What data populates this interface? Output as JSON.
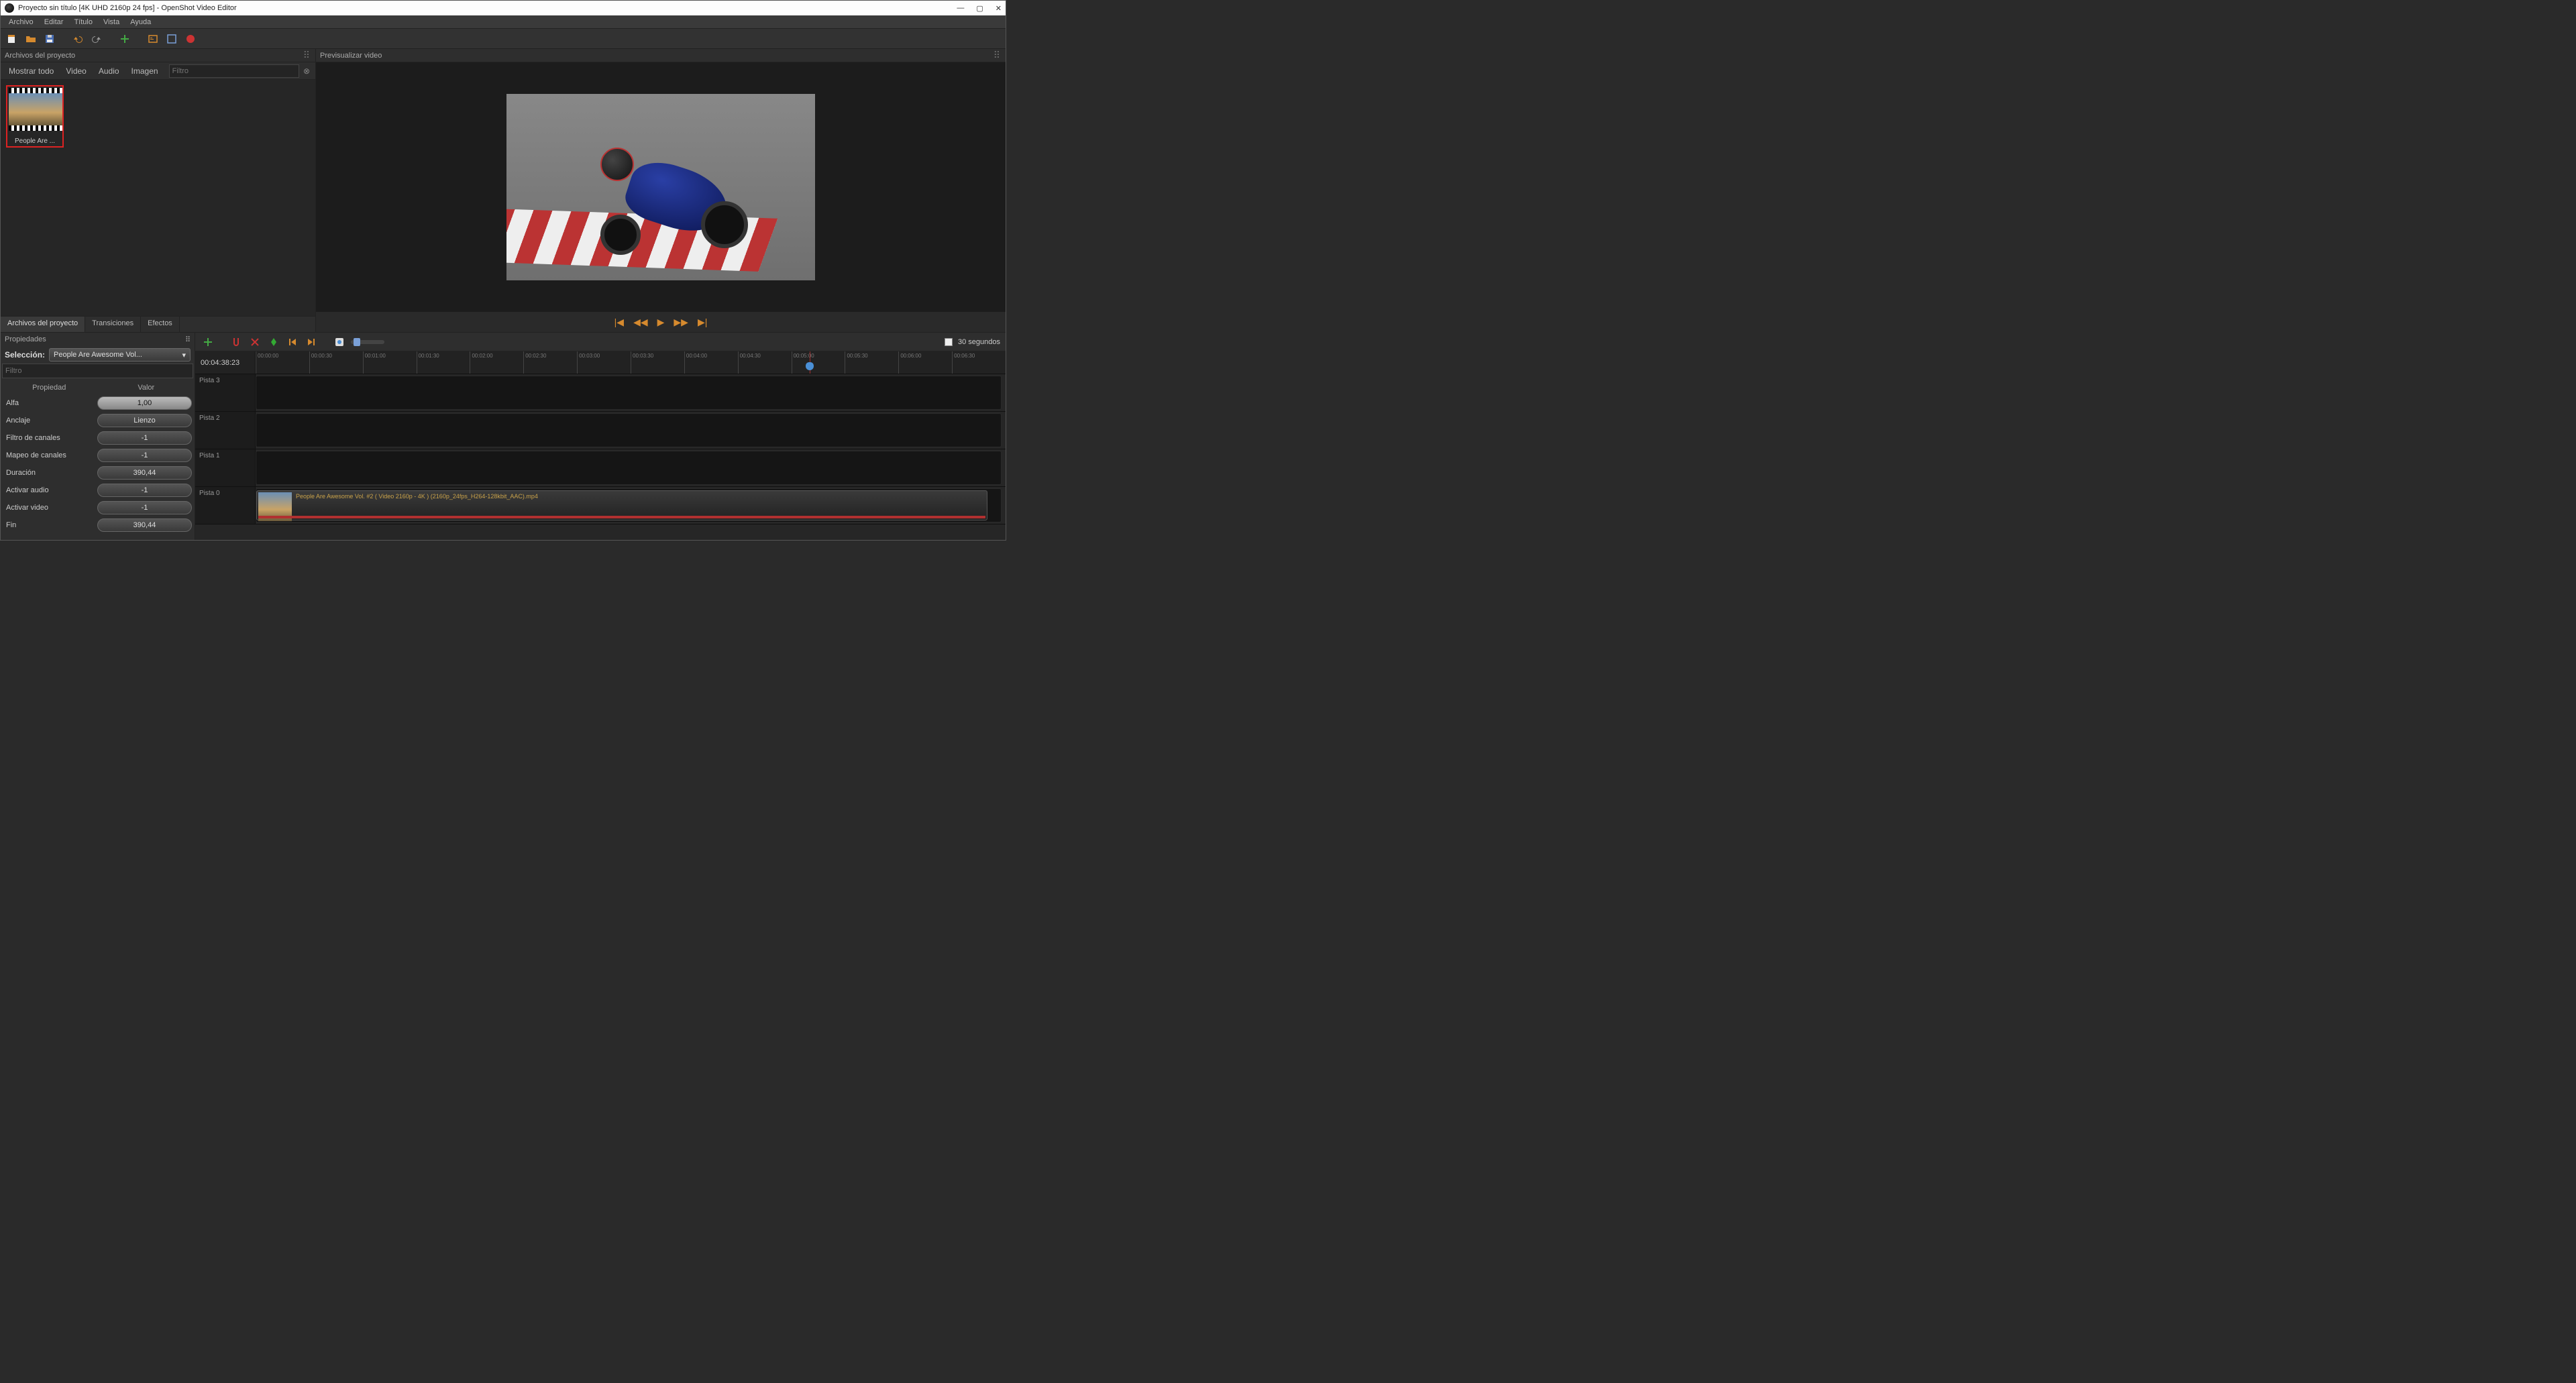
{
  "titlebar": {
    "title": "Proyecto sin título [4K UHD 2160p 24 fps] - OpenShot Video Editor"
  },
  "menubar": {
    "items": [
      "Archivo",
      "Editar",
      "Título",
      "Vista",
      "Ayuda"
    ]
  },
  "panels": {
    "project_files": {
      "title": "Archivos del proyecto",
      "filters": [
        "Mostrar todo",
        "Video",
        "Audio",
        "Imagen"
      ],
      "filter_placeholder": "Filtro",
      "thumb_label": "People Are ...",
      "tabs": [
        "Archivos del proyecto",
        "Transiciones",
        "Efectos"
      ]
    },
    "preview": {
      "title": "Previsualizar video"
    },
    "properties": {
      "title": "Propiedades",
      "selection_label": "Selección:",
      "selection_value": "People Are Awesome Vol...",
      "filter_placeholder": "Filtro",
      "head_prop": "Propiedad",
      "head_val": "Valor",
      "rows": [
        {
          "name": "Alfa",
          "value": "1,00",
          "hl": true
        },
        {
          "name": "Anclaje",
          "value": "Lienzo"
        },
        {
          "name": "Filtro de canales",
          "value": "-1"
        },
        {
          "name": "Mapeo de canales",
          "value": "-1"
        },
        {
          "name": "Duración",
          "value": "390,44"
        },
        {
          "name": "Activar audio",
          "value": "-1"
        },
        {
          "name": "Activar video",
          "value": "-1"
        },
        {
          "name": "Fin",
          "value": "390,44"
        }
      ]
    }
  },
  "timeline": {
    "snap_label": "30 segundos",
    "current_time": "00:04:38:23",
    "ticks": [
      "00:00:00",
      "00:00:30",
      "00:01:00",
      "00:01:30",
      "00:02:00",
      "00:02:30",
      "00:03:00",
      "00:03:30",
      "00:04:00",
      "00:04:30",
      "00:05:00",
      "00:05:30",
      "00:06:00",
      "00:06:30"
    ],
    "tracks": [
      "Pista 3",
      "Pista 2",
      "Pista 1",
      "Pista 0"
    ],
    "clip_title": "People Are Awesome Vol. #2 ( Video 2160p - 4K ) (2160p_24fps_H264-128kbit_AAC).mp4"
  }
}
